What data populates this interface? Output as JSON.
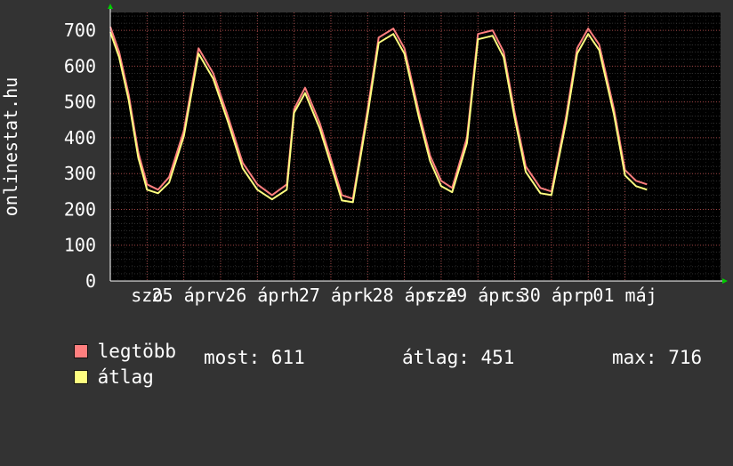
{
  "chart_data": {
    "type": "line",
    "ylabel": "onlinestat.hu",
    "ylim": [
      0,
      750
    ],
    "yticks": [
      0,
      100,
      200,
      300,
      400,
      500,
      600,
      700
    ],
    "xlim": [
      0,
      8.3
    ],
    "grid": true,
    "xtick_labels": [
      {
        "x": 0.5,
        "label": "szo"
      },
      {
        "x": 1.0,
        "label": "25 ápr"
      },
      {
        "x": 1.5,
        "label": "v"
      },
      {
        "x": 2.0,
        "label": "26 ápr"
      },
      {
        "x": 2.5,
        "label": "h"
      },
      {
        "x": 3.0,
        "label": "27 ápr"
      },
      {
        "x": 3.5,
        "label": "k"
      },
      {
        "x": 4.0,
        "label": "28 ápr"
      },
      {
        "x": 4.5,
        "label": "sze"
      },
      {
        "x": 5.0,
        "label": "29 ápr"
      },
      {
        "x": 5.5,
        "label": "cs"
      },
      {
        "x": 6.0,
        "label": "30 ápr"
      },
      {
        "x": 6.5,
        "label": "p"
      },
      {
        "x": 7.0,
        "label": "01 máj"
      }
    ],
    "series": [
      {
        "name": "legtöbb",
        "color": "#ff7f7f",
        "x": [
          0,
          0.12,
          0.25,
          0.38,
          0.5,
          0.65,
          0.8,
          1.0,
          1.2,
          1.4,
          1.6,
          1.8,
          2.0,
          2.2,
          2.4,
          2.5,
          2.65,
          2.85,
          3.0,
          3.15,
          3.3,
          3.5,
          3.65,
          3.85,
          4.0,
          4.2,
          4.35,
          4.5,
          4.65,
          4.85,
          5.0,
          5.2,
          5.35,
          5.5,
          5.65,
          5.85,
          6.0,
          6.2,
          6.35,
          6.5,
          6.65,
          6.85,
          7.0,
          7.15,
          7.3
        ],
        "y": [
          710,
          640,
          520,
          360,
          270,
          255,
          290,
          420,
          650,
          580,
          460,
          330,
          270,
          240,
          270,
          480,
          540,
          440,
          340,
          240,
          230,
          480,
          680,
          705,
          650,
          470,
          350,
          280,
          260,
          400,
          690,
          700,
          640,
          470,
          320,
          260,
          250,
          460,
          650,
          705,
          660,
          480,
          310,
          280,
          270
        ]
      },
      {
        "name": "átlag",
        "color": "#ffff80",
        "x": [
          0,
          0.12,
          0.25,
          0.38,
          0.5,
          0.65,
          0.8,
          1.0,
          1.2,
          1.4,
          1.6,
          1.8,
          2.0,
          2.2,
          2.4,
          2.5,
          2.65,
          2.85,
          3.0,
          3.15,
          3.3,
          3.5,
          3.65,
          3.85,
          4.0,
          4.2,
          4.35,
          4.5,
          4.65,
          4.85,
          5.0,
          5.2,
          5.35,
          5.5,
          5.65,
          5.85,
          6.0,
          6.2,
          6.35,
          6.5,
          6.65,
          6.85,
          7.0,
          7.15,
          7.3
        ],
        "y": [
          695,
          625,
          505,
          345,
          255,
          245,
          275,
          405,
          635,
          565,
          445,
          315,
          255,
          228,
          255,
          470,
          525,
          425,
          325,
          225,
          220,
          465,
          665,
          690,
          635,
          455,
          335,
          265,
          248,
          385,
          675,
          685,
          625,
          455,
          305,
          245,
          240,
          445,
          635,
          690,
          645,
          465,
          295,
          265,
          255
        ]
      }
    ],
    "legend": [
      {
        "name": "legtöbb",
        "color": "#ff7f7f"
      },
      {
        "name": "átlag",
        "color": "#ffff80"
      }
    ],
    "stats": {
      "most": "most: 611",
      "atlag": "átlag: 451",
      "max": "max: 716"
    }
  }
}
